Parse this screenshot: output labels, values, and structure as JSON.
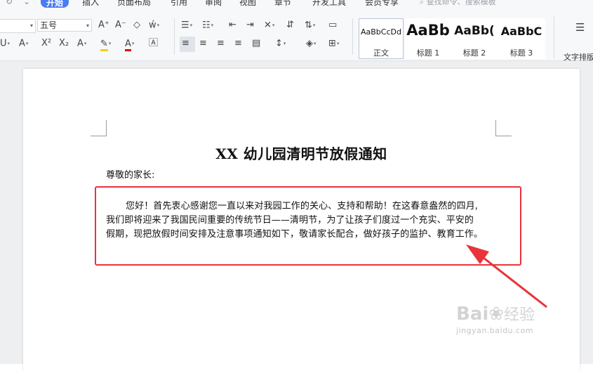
{
  "menu": {
    "tabs": [
      "开始",
      "插入",
      "页面布局",
      "引用",
      "审阅",
      "视图",
      "章节",
      "开发工具",
      "会员专享"
    ],
    "active_tab": "开始",
    "search_placeholder": "查找命令、搜索模板"
  },
  "toolbar": {
    "font_size": "五号",
    "styles": [
      {
        "sample": "AaBbCcDd",
        "name": "正文",
        "selected": true
      },
      {
        "sample": "AaBb",
        "name": "标题 1",
        "selected": false
      },
      {
        "sample": "AaBb(",
        "name": "标题 2",
        "selected": false
      },
      {
        "sample": "AaBbC",
        "name": "标题 3",
        "selected": false
      }
    ],
    "text_layout_label": "文字排版",
    "colors": {
      "accent": "#4a7cf0",
      "highlight": "#f5d000",
      "font_color": "#e00000"
    }
  },
  "document": {
    "title": "XX 幼儿园清明节放假通知",
    "salutation": "尊敬的家长:",
    "body_lines": [
      "您好！首先衷心感谢您一直以来对我园工作的关心、支持和帮助！在这春意盎然的四月,",
      "我们即将迎来了我国民间重要的传统节日——清明节，为了让孩子们度过一个充实、平安的",
      "假期，现把放假时间安排及注意事项通知如下，敬请家长配合，做好孩子的监护、教育工作。"
    ]
  },
  "annotation": {
    "color": "#e8333a"
  },
  "watermark": {
    "brand": "Bai",
    "brand_cn": "经验",
    "url": "jingyan.baidu.com"
  }
}
